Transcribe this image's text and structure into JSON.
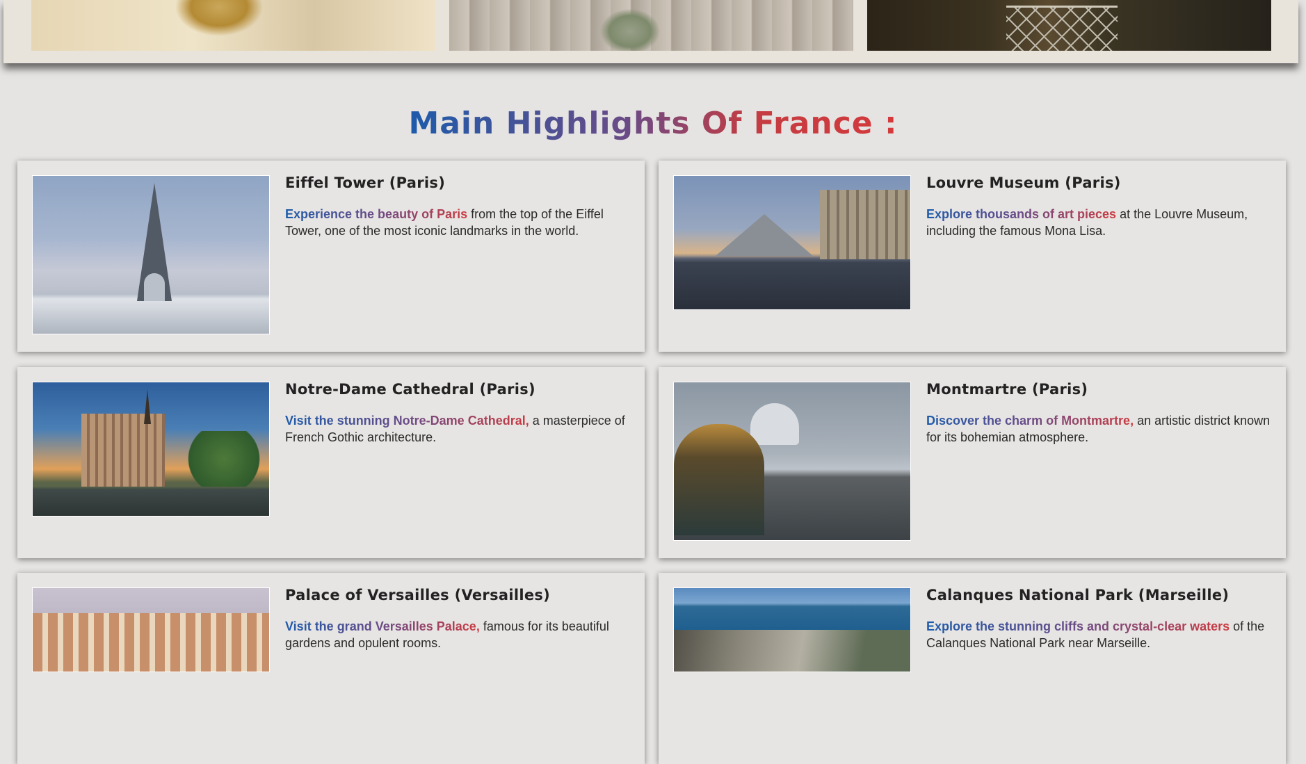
{
  "page": {
    "heading": "Main Highlights Of France :"
  },
  "gallery": {
    "images": [
      "map-with-compass",
      "olives-on-wooden-board",
      "railway-bridge-in-forest"
    ]
  },
  "highlights": [
    {
      "title": "Eiffel Tower (Paris)",
      "highlight": "Experience the beauty of Paris",
      "text": " from the top of the Eiffel Tower, one of the most iconic landmarks in the world.",
      "image": "eiffel-tower-photo"
    },
    {
      "title": "Louvre Museum (Paris)",
      "highlight": "Explore thousands of art pieces",
      "text": " at the Louvre Museum, including the famous Mona Lisa.",
      "image": "louvre-museum-photo"
    },
    {
      "title": "Notre-Dame Cathedral (Paris)",
      "highlight": "Visit the stunning Notre-Dame Cathedral,",
      "text": " a masterpiece of French Gothic architecture.",
      "image": "notre-dame-photo"
    },
    {
      "title": "Montmartre (Paris)",
      "highlight": "Discover the charm of Montmartre,",
      "text": " an artistic district known for its bohemian atmosphere.",
      "image": "montmartre-photo"
    },
    {
      "title": "Palace of Versailles (Versailles)",
      "highlight": "Visit the grand Versailles Palace,",
      "text": " famous for its beautiful gardens and opulent rooms.",
      "image": "versailles-photo"
    },
    {
      "title": "Calanques National Park (Marseille)",
      "highlight": "Explore the stunning cliffs and crystal-clear waters",
      "text": " of the Calanques National Park near Marseille.",
      "image": "calanques-photo"
    }
  ],
  "colors": {
    "gradient_start": "#1d5bab",
    "gradient_mid": "#6b4b86",
    "gradient_end": "#cc3b40",
    "background": "#e6e4e2",
    "card": "#e7e5e3"
  }
}
